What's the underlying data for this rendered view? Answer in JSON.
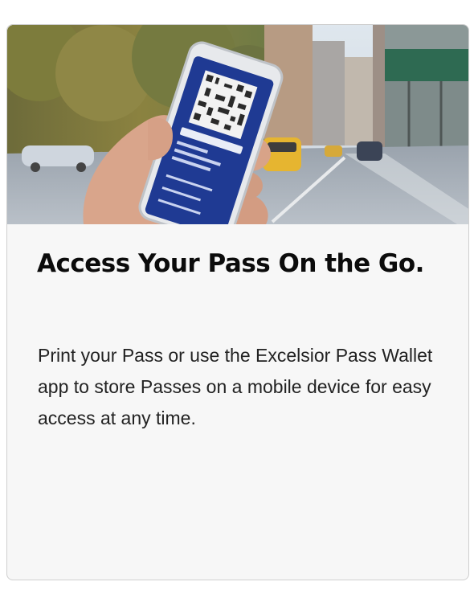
{
  "card": {
    "title": "Access Your Pass On the Go.",
    "description": "Print your Pass or use the Excelsior Pass Wallet app to store Passes on a mobile device for easy access at any time."
  },
  "colors": {
    "card_background": "#f7f7f7",
    "card_border": "#cfcfcf",
    "title_text": "#0b0b0b",
    "body_text": "#222222",
    "phone_screen": "#1f3a93"
  }
}
